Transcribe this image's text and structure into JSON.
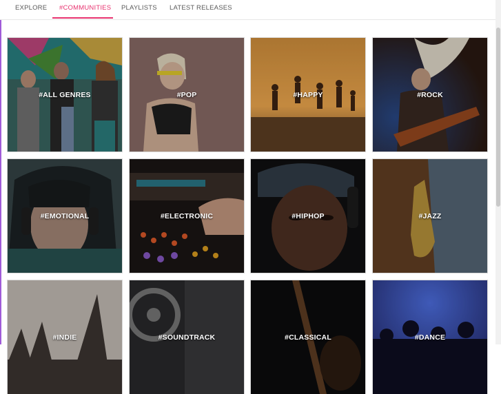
{
  "tabs": [
    {
      "label": "EXPLORE",
      "active": false
    },
    {
      "label": "#COMMUNITIES",
      "active": true
    },
    {
      "label": "PLAYLISTS",
      "active": false
    },
    {
      "label": "LATEST RELEASES",
      "active": false
    }
  ],
  "accent_color": "#e8326f",
  "communities": [
    {
      "label": "#ALL GENRES"
    },
    {
      "label": "#POP"
    },
    {
      "label": "#HAPPY"
    },
    {
      "label": "#ROCK"
    },
    {
      "label": "#EMOTIONAL"
    },
    {
      "label": "#ELECTRONIC"
    },
    {
      "label": "#HIPHOP"
    },
    {
      "label": "#JAZZ"
    },
    {
      "label": "#INDIE"
    },
    {
      "label": "#SOUNDTRACK"
    },
    {
      "label": "#CLASSICAL"
    },
    {
      "label": "#DANCE"
    }
  ]
}
